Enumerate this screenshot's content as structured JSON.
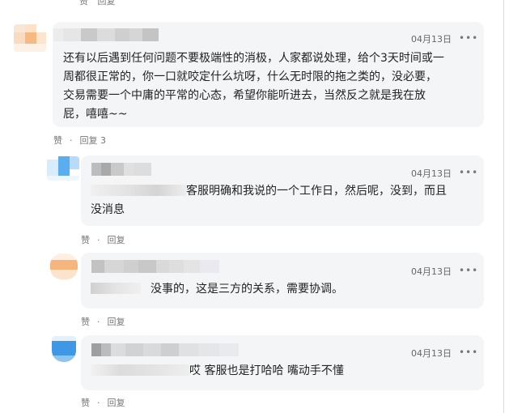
{
  "top_actions": {
    "like": "赞",
    "reply": "回复"
  },
  "comments": [
    {
      "date": "04月13日",
      "more": "•••",
      "text_lines": [
        "还有以后遇到任何问题不要极端性的消极，人家都说处理，给个3天时间或一",
        "周都很正常的，你一口就咬定什么坑呀，什么无时限的拖之类的，没必要，",
        "交易需要一个中庸的平常的心态，希望你能听进去，当然反之就是我在放",
        "屁，嘻嘻~~"
      ],
      "like": "赞",
      "reply": "回复 3"
    },
    {
      "date": "04月13日",
      "more": "•••",
      "text_line1": "客服明确和我说的一个工作日，然后呢，没到，而且",
      "text_line2": "没消息",
      "like": "赞",
      "reply": "回复"
    },
    {
      "date": "04月13日",
      "more": "•••",
      "text_line1": "没事的，这是三方的关系，需要协调。",
      "like": "赞",
      "reply": "回复"
    },
    {
      "date": "04月13日",
      "more": "•••",
      "text_line1": "哎 客服也是打哈哈 嘴动手不懂",
      "like": "赞",
      "reply": "回复"
    }
  ]
}
